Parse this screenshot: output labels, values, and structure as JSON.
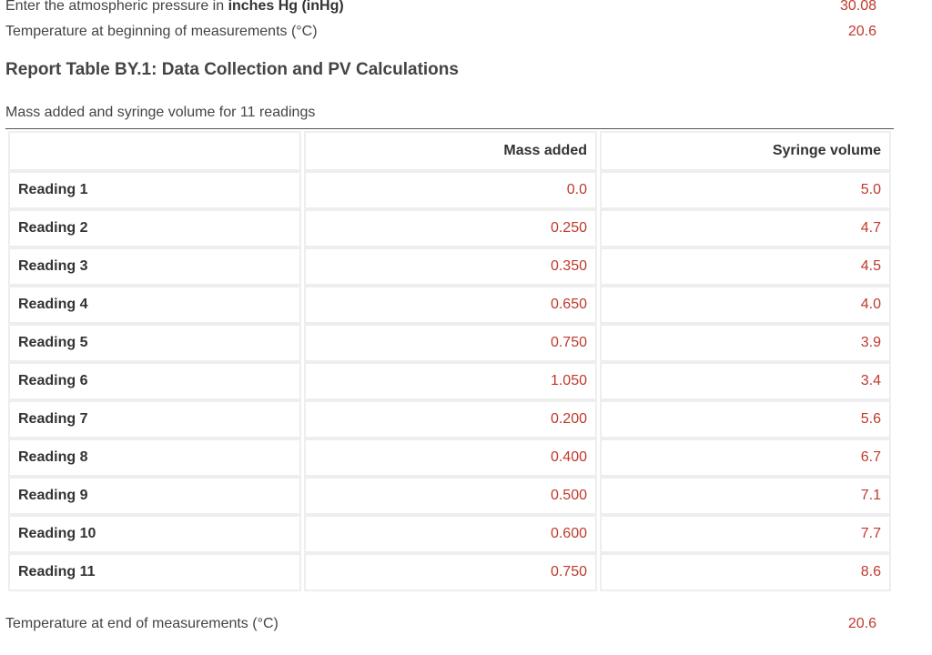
{
  "pressure": {
    "label_prefix": "Enter the atmospheric pressure in ",
    "label_bold": "inches Hg (inHg)",
    "value": "30.08"
  },
  "temp_start": {
    "label": "Temperature at beginning of measurements (°C)",
    "value": "20.6"
  },
  "report_title": "Report Table BY.1: Data Collection and PV Calculations",
  "caption": "Mass added and syringe volume for 11 readings",
  "columns": [
    "",
    "Mass added",
    "Syringe volume"
  ],
  "rows": [
    {
      "label": "Reading 1",
      "mass": "0.0",
      "volume": "5.0"
    },
    {
      "label": "Reading 2",
      "mass": "0.250",
      "volume": "4.7"
    },
    {
      "label": "Reading 3",
      "mass": "0.350",
      "volume": "4.5"
    },
    {
      "label": "Reading 4",
      "mass": "0.650",
      "volume": "4.0"
    },
    {
      "label": "Reading 5",
      "mass": "0.750",
      "volume": "3.9"
    },
    {
      "label": "Reading 6",
      "mass": "1.050",
      "volume": "3.4"
    },
    {
      "label": "Reading 7",
      "mass": "0.200",
      "volume": "5.6"
    },
    {
      "label": "Reading 8",
      "mass": "0.400",
      "volume": "6.7"
    },
    {
      "label": "Reading 9",
      "mass": "0.500",
      "volume": "7.1"
    },
    {
      "label": "Reading 10",
      "mass": "0.600",
      "volume": "7.7"
    },
    {
      "label": "Reading 11",
      "mass": "0.750",
      "volume": "8.6"
    }
  ],
  "temp_end": {
    "label": "Temperature at end of measurements (°C)",
    "value": "20.6"
  },
  "colors": {
    "value": "#c0392b",
    "text": "#333333",
    "border": "#eeeeee"
  }
}
